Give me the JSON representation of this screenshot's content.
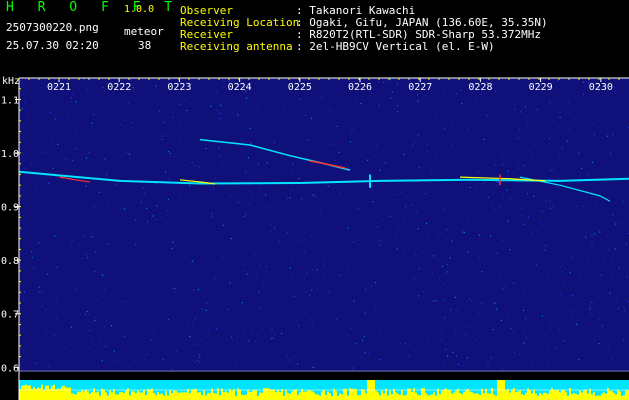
{
  "header": {
    "app_title": "H R O F F T",
    "version": "1.0.0",
    "filename": "2507300220.png",
    "datetime": "25.07.30 02:20",
    "meteor_label": "meteor",
    "meteor_count": "38"
  },
  "info": {
    "observer_label": "Observer",
    "observer_value": ": Takanori Kawachi",
    "location_label": "Receiving Location",
    "location_value": ": Ogaki, Gifu, JAPAN (136.60E, 35.35N)",
    "receiver_label": "Receiver",
    "receiver_value": ": R820T2(RTL-SDR) SDR-Sharp 53.372MHz",
    "antenna_label": "Receiving antenna",
    "antenna_value": ": 2el-HB9CV Vertical (el. E-W)"
  },
  "chart_data": {
    "type": "heatmap",
    "ylabel": "kHz",
    "time_ticks": [
      "0221",
      "0222",
      "0223",
      "0224",
      "0225",
      "0226",
      "0227",
      "0228",
      "0229",
      "0230"
    ],
    "freq_ticks": [
      {
        "label": "1.1",
        "value": 1.1
      },
      {
        "label": "1.0",
        "value": 1.0
      },
      {
        "label": "0.9",
        "value": 0.9
      },
      {
        "label": "0.8",
        "value": 0.8
      },
      {
        "label": "0.7",
        "value": 0.7
      },
      {
        "label": "0.6",
        "value": 0.6
      }
    ],
    "freq_range": [
      0.595,
      1.14
    ],
    "time_range": [
      2.2,
      2.5
    ]
  },
  "colors": {
    "background": "#10107a",
    "axis": "#ffffff",
    "signal_cyan": "#00e5ff",
    "signal_yellow": "#ffff00",
    "signal_red": "#ff3030",
    "bottom_bars": "#ffff00",
    "bottom_bg": "#00e5ff"
  }
}
